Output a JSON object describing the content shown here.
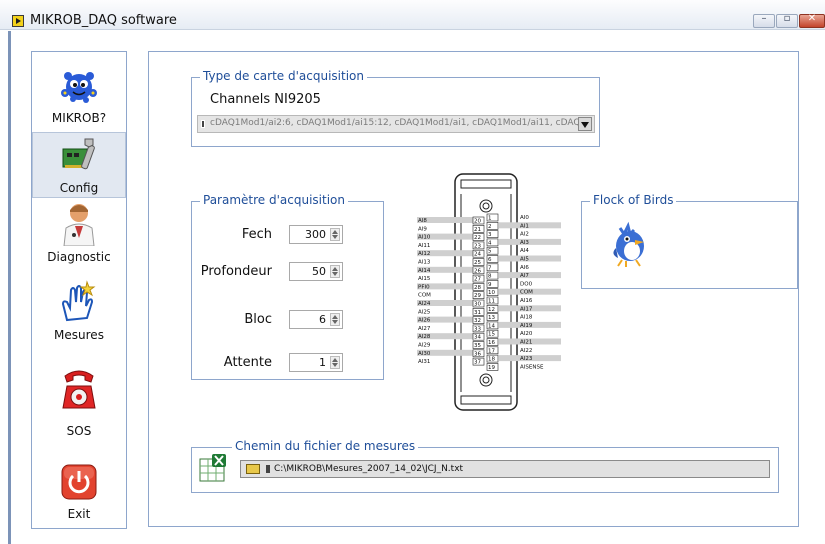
{
  "window": {
    "title": "MIKROB_DAQ software"
  },
  "window_buttons": [
    "–",
    "▫",
    "✕"
  ],
  "sidebar": {
    "items": [
      {
        "label": "MIKROB?",
        "icon": "mikrob-mascot-icon"
      },
      {
        "label": "Config",
        "icon": "daq-card-wrench-icon",
        "active": true
      },
      {
        "label": "Diagnostic",
        "icon": "doctor-icon"
      },
      {
        "label": "Mesures",
        "icon": "hand-pointer-icon"
      },
      {
        "label": "SOS",
        "icon": "red-telephone-icon"
      },
      {
        "label": "Exit",
        "icon": "power-button-icon"
      }
    ]
  },
  "acquisition_card": {
    "legend": "Type de carte d'acquisition",
    "channels_label": "Channels NI9205",
    "channels_value": "cDAQ1Mod1/ai2:6, cDAQ1Mod1/ai15:12, cDAQ1Mod1/ai1, cDAQ1Mod1/ai11, cDAQ1Mod1/"
  },
  "acquisition_params": {
    "legend": "Paramètre d'acquisition",
    "fields": [
      {
        "label": "Fech",
        "value": "300"
      },
      {
        "label": "Profondeur",
        "value": "50"
      },
      {
        "label": "Bloc",
        "value": "6"
      },
      {
        "label": "Attente",
        "value": "1"
      }
    ]
  },
  "connector": {
    "left_labels": [
      "AI8",
      "AI9",
      "AI10",
      "AI11",
      "AI12",
      "AI13",
      "AI14",
      "AI15",
      "PFI0",
      "COM",
      "AI24",
      "AI25",
      "AI26",
      "AI27",
      "AI28",
      "AI29",
      "AI30",
      "AI31"
    ],
    "right_labels": [
      "AI0",
      "AI1",
      "AI2",
      "AI3",
      "AI4",
      "AI5",
      "AI6",
      "AI7",
      "DO0",
      "COM",
      "AI16",
      "AI17",
      "AI18",
      "AI19",
      "AI20",
      "AI21",
      "AI22",
      "AI23",
      "AISENSE"
    ],
    "left_pins": [
      "20",
      "21",
      "22",
      "23",
      "24",
      "25",
      "26",
      "27",
      "28",
      "29",
      "30",
      "31",
      "32",
      "33",
      "34",
      "35",
      "36",
      "37"
    ],
    "right_pins": [
      "1",
      "2",
      "3",
      "4",
      "5",
      "6",
      "7",
      "8",
      "9",
      "10",
      "11",
      "12",
      "13",
      "14",
      "15",
      "16",
      "17",
      "18",
      "19"
    ]
  },
  "flock": {
    "legend": "Flock of Birds",
    "icon": "bird-icon"
  },
  "file_path": {
    "legend": "Chemin du fichier de mesures",
    "icon": "spreadsheet-icon",
    "folder_icon": "folder-open-icon",
    "value": "C:\\MIKROB\\Mesures_2007_14_02\\JCJ_N.txt"
  },
  "colors": {
    "accent": "#1f4e99",
    "frame": "#8ea6cc"
  }
}
